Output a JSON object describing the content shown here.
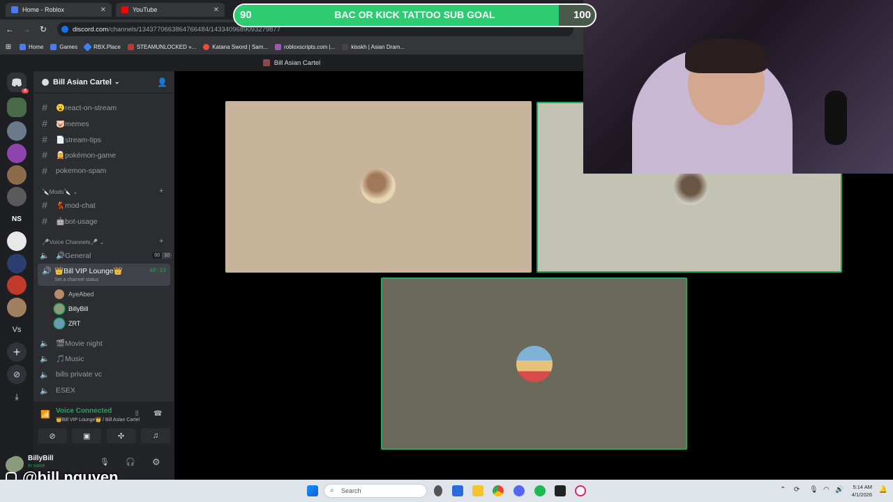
{
  "browser": {
    "tabs": [
      {
        "label": "Home - Roblox"
      },
      {
        "label": "YouTube"
      }
    ],
    "url_host": "discord.com",
    "url_path": "/channels/1343770663864766484/1433409689093279877",
    "bookmarks": [
      {
        "label": "Home"
      },
      {
        "label": "Games"
      },
      {
        "label": "RBX.Place"
      },
      {
        "label": "STEAMUNLOCKED »..."
      },
      {
        "label": "Katana Sword | Sam..."
      },
      {
        "label": "robloxscripts.com |..."
      },
      {
        "label": "kisskh | Asian Dram..."
      }
    ]
  },
  "goal": {
    "left": "90",
    "title": "BAC OR KICK TATTOO SUB GOAL",
    "right": "100",
    "progress_fraction": 0.9
  },
  "discord": {
    "window_title": "Bill Asian Cartel",
    "server_name": "Bill Asian Cartel",
    "mention_badge": "4",
    "text_channels": [
      "😮react-on-stream",
      "🐷memes",
      "📄stream-tips",
      "🧝pokémon-game",
      "pokemon-spam"
    ],
    "mods_category": "🔪Mods🔪",
    "mods_channels": [
      "💃mod-chat",
      "🤖bot-usage"
    ],
    "voice_category": "🎤Voice Channels🎤",
    "voice_channels": {
      "general": "🔊General",
      "general_count_a": "00",
      "general_count_b": "10",
      "lounge": "👑Bill VIP Lounge👑",
      "lounge_time": "48:33",
      "lounge_status": "Set a channel status",
      "lounge_users": [
        "AyeAbed",
        "BillyBill",
        "ZRT"
      ],
      "others": [
        "🎬Movie night",
        "🎵Music",
        "bills private vc",
        "ESEX"
      ]
    },
    "voice_connected": {
      "title": "Voice Connected",
      "subtitle": "👑Bill VIP Lounge👑 / Bill Asian Cartel"
    },
    "user": {
      "name": "BillyBill",
      "status": "In voice"
    },
    "server_icon_labels": [
      "NS",
      "Vs"
    ]
  },
  "overlay": {
    "handle": "@bill.nguyen"
  },
  "taskbar": {
    "search_placeholder": "Search",
    "time": "5:14 AM",
    "date": "4/1/2026"
  },
  "colors": {
    "accent_green": "#23a55a",
    "goal_green": "#2ecc71",
    "discord_bg": "#2b2d31"
  }
}
